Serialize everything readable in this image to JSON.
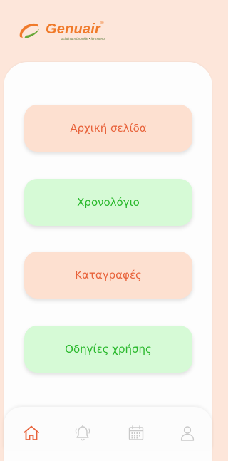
{
  "header": {
    "brand": "Genuair",
    "brand_mark": "®",
    "tagline": "aclidinium bromide • formoterol"
  },
  "menu": {
    "items": [
      {
        "label": "Αρχική σελίδα",
        "style": "orange"
      },
      {
        "label": "Χρονολόγιο",
        "style": "green"
      },
      {
        "label": "Καταγραφές",
        "style": "orange"
      },
      {
        "label": "Οδηγίες χρήσης",
        "style": "green"
      }
    ]
  },
  "tabbar": {
    "items": [
      {
        "icon": "home-icon",
        "active": true
      },
      {
        "icon": "bell-icon",
        "active": false
      },
      {
        "icon": "calendar-icon",
        "active": false
      },
      {
        "icon": "user-icon",
        "active": false
      }
    ]
  },
  "colors": {
    "background": "#fde6da",
    "accent_orange": "#e8623a",
    "accent_green": "#28b82b",
    "button_orange_bg": "#fde0d0",
    "button_green_bg": "#d6fad6",
    "icon_inactive": "#c9c9c9"
  }
}
